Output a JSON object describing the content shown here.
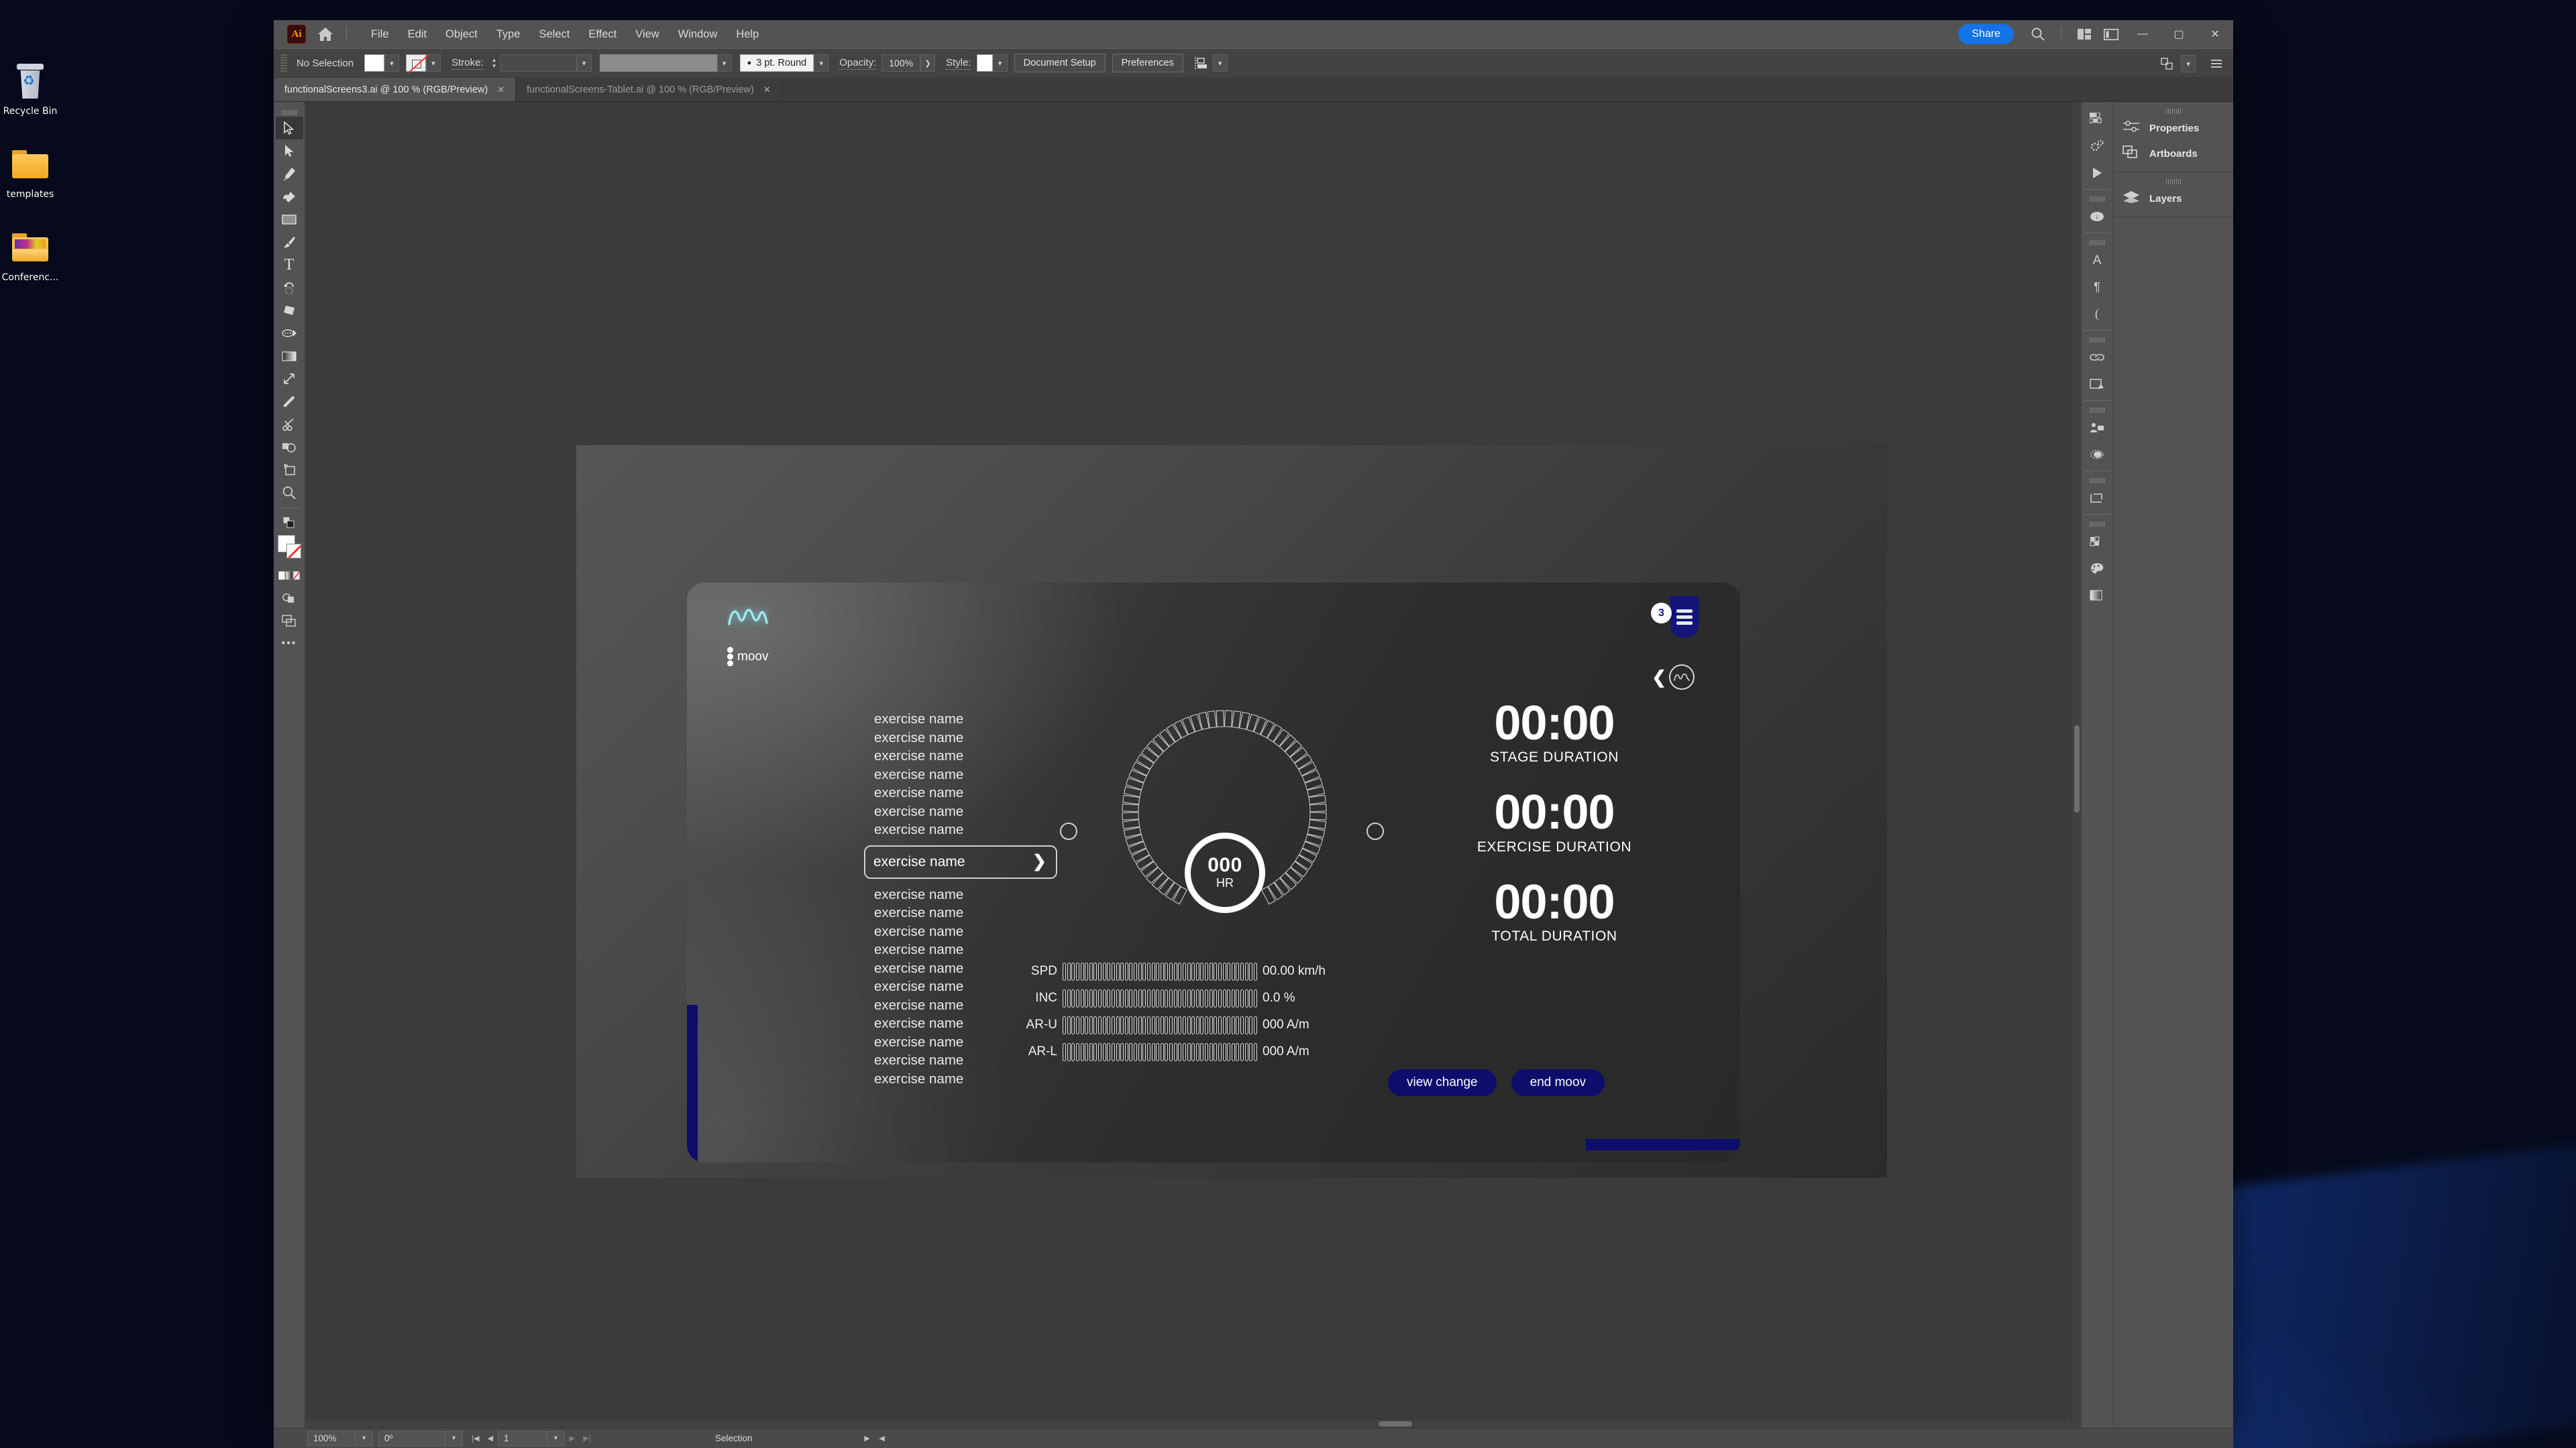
{
  "desktop": {
    "icons": [
      {
        "name": "recycle-bin",
        "label": "Recycle Bin"
      },
      {
        "name": "templates-folder",
        "label": "templates"
      },
      {
        "name": "conference-folder",
        "label": "Conferenc..."
      }
    ]
  },
  "app": {
    "logo_text": "Ai",
    "menus": [
      "File",
      "Edit",
      "Object",
      "Type",
      "Select",
      "Effect",
      "View",
      "Window",
      "Help"
    ],
    "share_label": "Share",
    "window_buttons": {
      "minimize": "—",
      "maximize": "▢",
      "close": "✕"
    }
  },
  "control_bar": {
    "selection_label": "No Selection",
    "stroke_label": "Stroke:",
    "stroke_profile": "3 pt. Round",
    "opacity_label": "Opacity:",
    "opacity_value": "100%",
    "style_label": "Style:",
    "document_setup": "Document Setup",
    "preferences": "Preferences"
  },
  "tabs": [
    {
      "title": "functionalScreens3.ai @ 100 % (RGB/Preview)",
      "close": "✕",
      "active": true
    },
    {
      "title": "functionalScreens-Tablet.ai @ 100 % (RGB/Preview)",
      "close": "✕",
      "active": false
    }
  ],
  "tools": [
    "selection-tool",
    "direct-selection-tool",
    "pen-tool",
    "curvature-tool",
    "rectangle-tool",
    "paintbrush-tool",
    "type-tool",
    "rotate-tool",
    "shaper-tool",
    "width-tool",
    "free-transform-tool",
    "eyedropper-tool",
    "scissors-tool",
    "shape-builder-tool",
    "artboard-tool",
    "zoom-tool"
  ],
  "right_panel": {
    "groups": [
      {
        "items": [
          {
            "icon": "sliders-icon",
            "label": "Properties"
          },
          {
            "icon": "artboards-icon",
            "label": "Artboards"
          }
        ]
      },
      {
        "items": [
          {
            "icon": "layers-icon",
            "label": "Layers"
          }
        ]
      }
    ]
  },
  "status_bar": {
    "zoom": "100%",
    "rotation": "0º",
    "artboard_number": "1",
    "tool_status": "Selection"
  },
  "mockup": {
    "brand": "moov",
    "logo_name": "moov-wave-logo",
    "menu_badge": "3",
    "exercise_list": [
      "exercise name",
      "exercise name",
      "exercise name",
      "exercise name",
      "exercise name",
      "exercise name",
      "exercise name"
    ],
    "selected_exercise": {
      "label": "exercise name",
      "arrow": "❯"
    },
    "exercise_list_after": [
      "exercise name",
      "exercise name",
      "exercise name",
      "exercise name",
      "exercise name",
      "exercise name",
      "exercise name",
      "exercise name",
      "exercise name",
      "exercise name",
      "exercise name"
    ],
    "heart_rate": {
      "value": "000",
      "unit": "HR"
    },
    "durations": [
      {
        "value": "00:00",
        "label": "STAGE DURATION"
      },
      {
        "value": "00:00",
        "label": "EXERCISE DURATION"
      },
      {
        "value": "00:00",
        "label": "TOTAL DURATION"
      }
    ],
    "metrics": [
      {
        "key": "SPD",
        "value": "00.00 km/h"
      },
      {
        "key": "INC",
        "value": "0.0 %"
      },
      {
        "key": "AR-U",
        "value": "000 A/m"
      },
      {
        "key": "AR-L",
        "value": "000 A/m"
      }
    ],
    "buttons": [
      {
        "name": "view-change-button",
        "label": "view change"
      },
      {
        "name": "end-moov-button",
        "label": "end moov"
      }
    ],
    "colors": {
      "navy": "#0d0d6b",
      "menu_navy": "#14147a",
      "logo_cyan": "#9fe8ee",
      "text": "#ffffff"
    }
  },
  "theme": {
    "app_chrome": "#535353",
    "canvas": "#3b3b3b",
    "share_blue": "#1473e6"
  }
}
